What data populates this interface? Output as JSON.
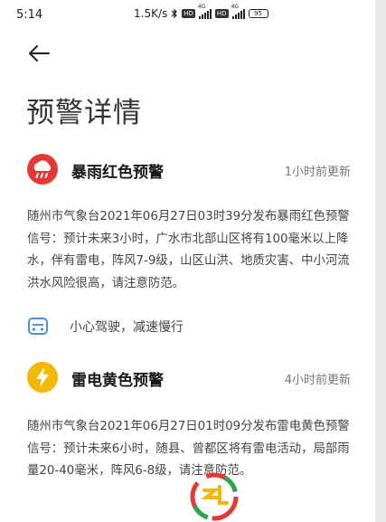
{
  "status_bar": {
    "time": "5:14",
    "speed": "1.5K/s",
    "icons": [
      "bluetooth-icon",
      "hd-icon",
      "signal-4g-icon",
      "hd-icon",
      "signal-4g-icon",
      "battery-icon"
    ],
    "network": "4G",
    "hd_label": "HD",
    "battery": "95"
  },
  "header": {
    "back_icon": "arrow-left-icon",
    "title": "预警详情"
  },
  "alerts": [
    {
      "title": "暴雨红色预警",
      "time": "1小时前更新",
      "icon": "rainstorm-icon",
      "color": "#e53935",
      "description": "随州市气象台2021年06月27日03时39分发布暴雨红色预警信号：预计未来3小时，广水市北部山区将有100毫米以上降水，伴有雷电，阵风7-9级，山区山洪、地质灾害、中小河流洪水风险很高，请注意防范。",
      "advice_icon": "car-icon",
      "advice": "小心驾驶，减速慢行"
    },
    {
      "title": "雷电黄色预警",
      "time": "4小时前更新",
      "icon": "lightning-icon",
      "color": "#f5b800",
      "description": "随州市气象台2021年06月27日01时09分发布雷电黄色预警信号：预计未来6小时，随县、曾都区将有雷电活动，局部雨量20-40毫米，阵风6-8级，请注意防范。"
    }
  ],
  "colors": {
    "accent_car": "#4a90e2",
    "text_secondary": "#777777"
  }
}
